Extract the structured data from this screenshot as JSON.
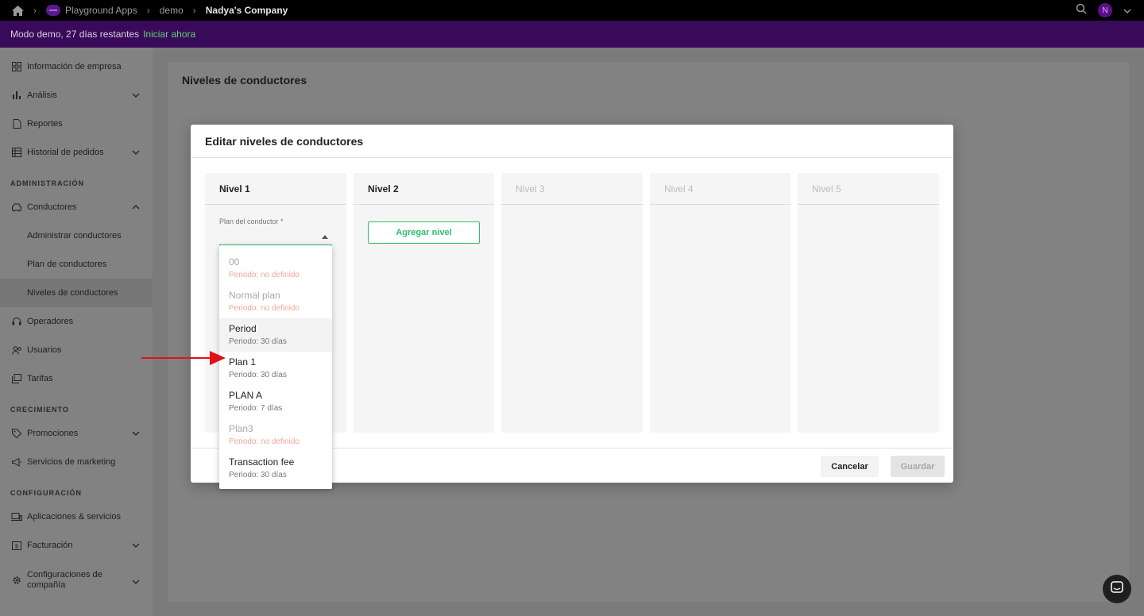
{
  "topbar": {
    "breadcrumbs": [
      "Playground Apps",
      "demo",
      "Nadya's Company"
    ],
    "avatar_initial": "N"
  },
  "banner": {
    "message": "Modo demo, 27 días restantes",
    "cta": "Iniciar ahora"
  },
  "sidebar": {
    "items": [
      {
        "label": "Información de empresa"
      },
      {
        "label": "Análisis"
      },
      {
        "label": "Reportes"
      },
      {
        "label": "Historial de pedidos"
      },
      {
        "label": "Conductores"
      },
      {
        "label": "Administrar conductores"
      },
      {
        "label": "Plan de conductores"
      },
      {
        "label": "Niveles de conductores"
      },
      {
        "label": "Operadores"
      },
      {
        "label": "Usuarios"
      },
      {
        "label": "Tarifas"
      },
      {
        "label": "Promociones"
      },
      {
        "label": "Servicios de marketing"
      },
      {
        "label": "Aplicaciones & servicios"
      },
      {
        "label": "Facturación"
      },
      {
        "label": "Configuraciones de compañía"
      }
    ],
    "sections": [
      "ADMINISTRACIÓN",
      "CRECIMIENTO",
      "CONFIGURACIÓN"
    ]
  },
  "main": {
    "title": "Niveles de conductores"
  },
  "modal": {
    "title": "Editar niveles de conductores",
    "levels": [
      "Nivel 1",
      "Nivel 2",
      "Nivel 3",
      "Nivel 4",
      "Nivel 5"
    ],
    "field_label": "Plan del conductor *",
    "add_level": "Agregar nivel",
    "cancel": "Cancelar",
    "save": "Guardar"
  },
  "dropdown": {
    "options": [
      {
        "name": "00",
        "period": "Periodo: no definido",
        "disabled": true
      },
      {
        "name": "Normal plan",
        "period": "Periodo: no definido",
        "disabled": true
      },
      {
        "name": "Period",
        "period": "Periodo: 30 días",
        "disabled": false
      },
      {
        "name": "Plan 1",
        "period": "Periodo: 30 días",
        "disabled": false
      },
      {
        "name": "PLAN A",
        "period": "Periodo: 7 días",
        "disabled": false
      },
      {
        "name": "Plan3",
        "period": "Periodo: no definido",
        "disabled": true
      },
      {
        "name": "Transaction fee",
        "period": "Periodo: 30 días",
        "disabled": false
      }
    ]
  },
  "colors": {
    "accent_green": "#2fbe6d",
    "banner_purple": "#3a0a5a",
    "annotation_red": "#e3101a"
  }
}
